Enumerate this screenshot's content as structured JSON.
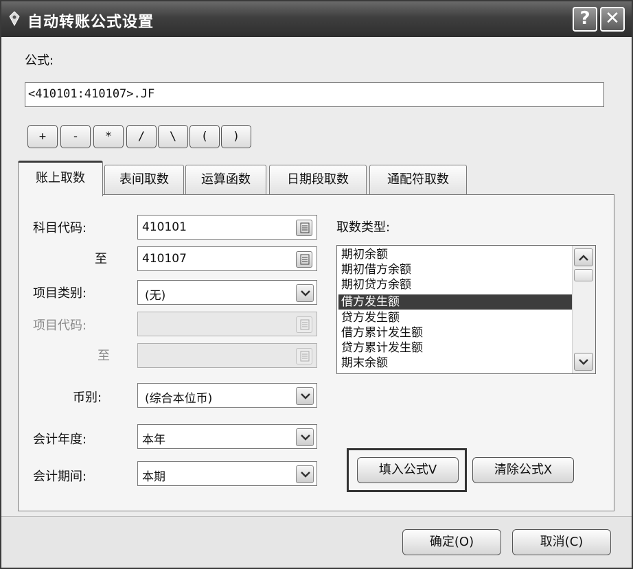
{
  "window": {
    "title": "自动转账公式设置",
    "help_glyph": "?",
    "close_glyph": "✕"
  },
  "formula": {
    "label": "公式:",
    "value": "<410101:410107>.JF"
  },
  "operators": [
    "+",
    "-",
    "*",
    "/",
    "\\",
    "(",
    ")"
  ],
  "tabs": [
    {
      "label": "账上取数",
      "active": true
    },
    {
      "label": "表间取数",
      "active": false
    },
    {
      "label": "运算函数",
      "active": false
    },
    {
      "label": "日期段取数",
      "active": false
    },
    {
      "label": "通配符取数",
      "active": false
    }
  ],
  "fields": {
    "account_code": {
      "label": "科目代码:",
      "value": "410101"
    },
    "account_to": {
      "label": "至",
      "value": "410107"
    },
    "item_category": {
      "label": "项目类别:",
      "value": "(无)"
    },
    "item_code": {
      "label": "项目代码:",
      "value": ""
    },
    "item_to": {
      "label": "至",
      "value": ""
    },
    "currency": {
      "label": "币别:",
      "value": "(综合本位币)"
    },
    "fiscal_year": {
      "label": "会计年度:",
      "value": "本年"
    },
    "fiscal_period": {
      "label": "会计期间:",
      "value": "本期"
    }
  },
  "fetch_type": {
    "label": "取数类型:",
    "options": [
      "期初余额",
      "期初借方余额",
      "期初贷方余额",
      "借方发生额",
      "贷方发生额",
      "借方累计发生额",
      "贷方累计发生额",
      "期末余额"
    ],
    "selected_index": 3
  },
  "actions": {
    "fill_formula": "填入公式V",
    "clear_formula": "清除公式X"
  },
  "footer": {
    "ok": "确定(O)",
    "cancel": "取消(C)"
  },
  "icons": {
    "title": "app-icon",
    "browse": "list-browse-icon",
    "dropdown": "chevron-down-icon",
    "scroll_up": "chevron-up-icon",
    "scroll_down": "chevron-down-icon"
  }
}
